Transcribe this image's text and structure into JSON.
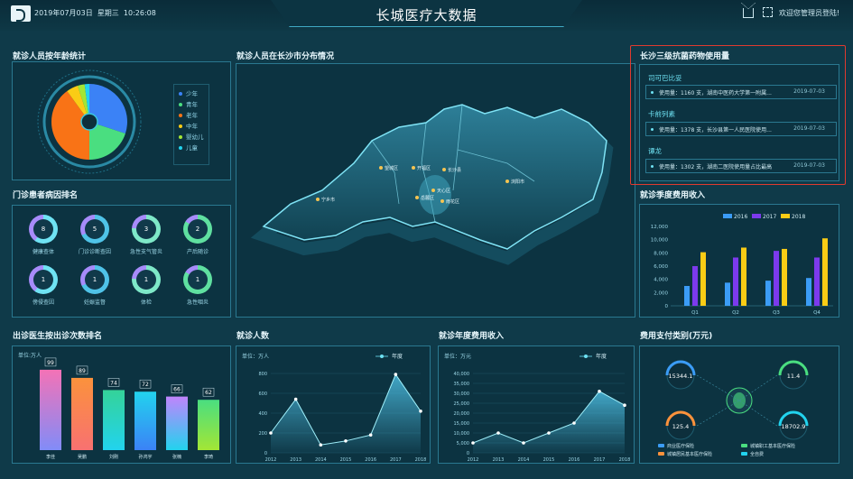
{
  "header": {
    "date": "2019年07月03日",
    "weekday": "星期三",
    "time": "10:26:08",
    "title": "长城医疗大数据",
    "welcome": "欢迎您管理员登陆!"
  },
  "age": {
    "title": "就诊人员按年龄统计",
    "legend": [
      "少年",
      "青年",
      "老年",
      "中年",
      "婴幼儿",
      "儿童"
    ],
    "colors": [
      "#3b82f6",
      "#4ade80",
      "#f97316",
      "#facc15",
      "#a3e635",
      "#22d3ee"
    ],
    "values": [
      30,
      20,
      40,
      5,
      3,
      2
    ]
  },
  "map": {
    "title": "就诊人员在长沙市分布情况",
    "labels": [
      "望城区",
      "开福区",
      "长沙县",
      "岳麓区",
      "天心区",
      "雨花区",
      "浏阳市",
      "宁乡市"
    ]
  },
  "antibiotic": {
    "title": "长沙三级抗菌药物使用量",
    "items": [
      {
        "name": "司可巴比妥",
        "detail": "使用量：1160 支，湖南中医药大学第一附属...",
        "date": "2019-07-03"
      },
      {
        "name": "卡前列素",
        "detail": "使用量：1378 支，长沙县第一人民医院使用...",
        "date": "2019-07-03"
      },
      {
        "name": "谭龙",
        "detail": "使用量：1302 支，湖南二医院使用量占比最高",
        "date": "2019-07-03"
      }
    ]
  },
  "disease": {
    "title": "门诊患者病因排名",
    "items": [
      {
        "value": "8",
        "label": "健康查体"
      },
      {
        "value": "5",
        "label": "门诊诊断查因"
      },
      {
        "value": "3",
        "label": "急性支气管炎"
      },
      {
        "value": "2",
        "label": "产后随诊"
      },
      {
        "value": "1",
        "label": "傍侵查因"
      },
      {
        "value": "1",
        "label": "妊娠监督"
      },
      {
        "value": "1",
        "label": "体检"
      },
      {
        "value": "1",
        "label": "急性咽炎"
      }
    ]
  },
  "season": {
    "title": "就诊季度费用收入",
    "legend": [
      "2016",
      "2017",
      "2018"
    ]
  },
  "doctor": {
    "title": "出诊医生按出诊次数排名",
    "unit": "单位:万人"
  },
  "visits": {
    "title": "就诊人数",
    "unit": "单位：万人",
    "legend": "年度"
  },
  "annual": {
    "title": "就诊年度费用收入",
    "unit": "单位：万元",
    "legend": "年度"
  },
  "payment": {
    "title": "费用支付类别(万元)",
    "values": [
      "15344.1",
      "11.4",
      "125.4",
      "18702.9"
    ],
    "legend": [
      "商业医疗保险",
      "城镇职工基本医疗保险",
      "城镇居民基本医疗保险",
      "全自费"
    ],
    "colors": [
      "#3b9cf6",
      "#4ade80",
      "#fb923c",
      "#22d3ee"
    ]
  },
  "chart_data": [
    {
      "type": "bar",
      "title": "就诊季度费用收入",
      "categories": [
        "Q1",
        "Q2",
        "Q3",
        "Q4"
      ],
      "ylim": [
        0,
        12000
      ],
      "yticks": [
        "0",
        "2,000",
        "4,000",
        "6,000",
        "8,000",
        "10,000",
        "12,000"
      ],
      "series": [
        {
          "name": "2016",
          "values": [
            3000,
            3500,
            3800,
            4200
          ]
        },
        {
          "name": "2017",
          "values": [
            6000,
            7300,
            8300,
            7300
          ]
        },
        {
          "name": "2018",
          "values": [
            8100,
            8800,
            8600,
            10200
          ]
        }
      ]
    },
    {
      "type": "bar",
      "title": "出诊医生按出诊次数排名",
      "categories": [
        "李佳",
        "吴鹏",
        "刘刚",
        "孙鸿宇",
        "张楠",
        "李琦"
      ],
      "values": [
        99,
        89,
        74,
        72,
        66,
        62
      ],
      "ylim": [
        0,
        100
      ],
      "unit": "单位:万人"
    },
    {
      "type": "area",
      "title": "就诊人数",
      "x": [
        "2012",
        "2013",
        "2014",
        "2015",
        "2016",
        "2017",
        "2018"
      ],
      "values": [
        200,
        540,
        80,
        120,
        180,
        790,
        420
      ],
      "ylim": [
        0,
        800
      ],
      "yticks": [
        "0",
        "200",
        "400",
        "600",
        "800"
      ]
    },
    {
      "type": "area",
      "title": "就诊年度费用收入",
      "x": [
        "2012",
        "2013",
        "2014",
        "2015",
        "2016",
        "2017",
        "2018"
      ],
      "values": [
        5000,
        10000,
        5000,
        10000,
        15000,
        31000,
        24000
      ],
      "ylim": [
        0,
        40000
      ],
      "yticks": [
        "0",
        "5,000",
        "10,000",
        "15,000",
        "20,000",
        "25,000",
        "30,000",
        "35,000",
        "40,000"
      ]
    }
  ]
}
